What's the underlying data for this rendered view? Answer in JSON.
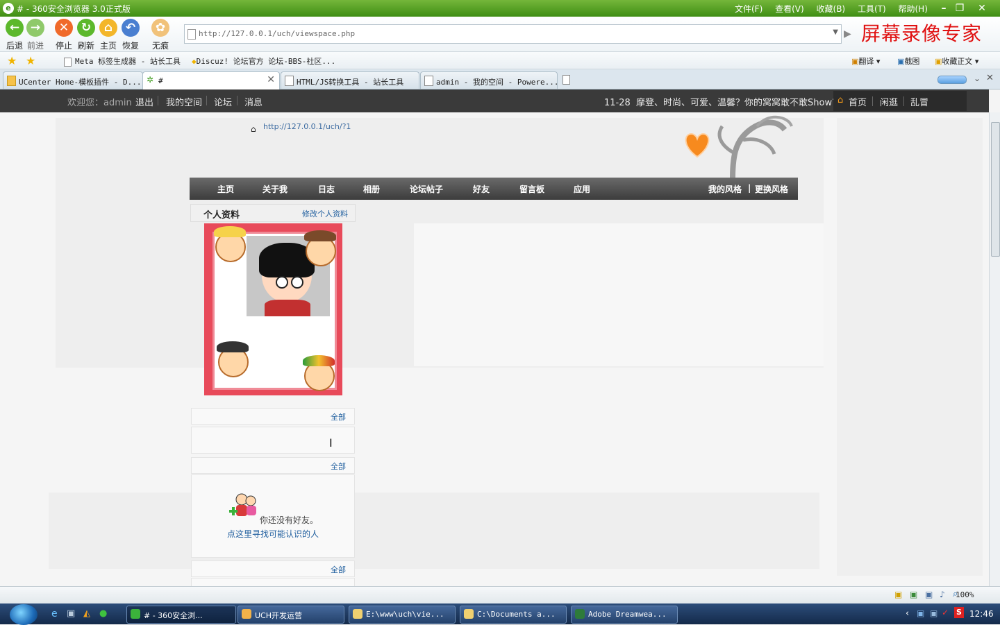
{
  "browser": {
    "title": "# - 360安全浏览器 3.0正式版",
    "menu": [
      "文件(F)",
      "查看(V)",
      "收藏(B)",
      "工具(T)",
      "帮助(H)"
    ],
    "toolbar": {
      "back": "后退",
      "forward": "前进",
      "stop": "停止",
      "refresh": "刷新",
      "home": "主页",
      "restore": "恢复",
      "incognito": "无痕"
    },
    "address": "http://127.0.0.1/uch/viewspace.php",
    "watermark": "屏幕录像专家",
    "favorites": [
      "Meta 标签生成器 - 站长工具",
      "Discuz! 论坛官方 论坛-BBS-社区..."
    ],
    "fav_right": [
      "翻译",
      "截图",
      "收藏正文"
    ],
    "tabs": [
      {
        "label": "UCenter Home-模板插件 - D..."
      },
      {
        "label": "#"
      },
      {
        "label": "HTML/JS转换工具 - 站长工具"
      },
      {
        "label": "admin - 我的空间 - Powere..."
      }
    ],
    "zoom": "100%"
  },
  "site": {
    "topbar": {
      "welcome": "欢迎您：admin",
      "logout": "退出",
      "myspace": "我的空间",
      "forum": "论坛",
      "messages": "消息",
      "news": "11-28  摩登、时尚、可爱、温馨？你的窝窝敢不敢Show?",
      "right_links": [
        "首页",
        "闲逛",
        "乱冒"
      ]
    },
    "space_url": "http://127.0.0.1/uch/?1",
    "nav": [
      "主页",
      "关于我",
      "日志",
      "相册",
      "论坛帖子",
      "好友",
      "留言板",
      "应用"
    ],
    "nav_right": [
      "我的风格",
      "更换风格"
    ],
    "profile": {
      "title": "个人资料",
      "edit": "修改个人资料"
    },
    "more_label": "全部",
    "no_friends": "你还没有好友。",
    "find_people": "点这里寻找可能认识的人"
  },
  "taskbar": {
    "tasks": [
      "# - 360安全浏...",
      "UCH开发运营",
      "E:\\www\\uch\\vie...",
      "C:\\Documents a...",
      "Adobe Dreamwea..."
    ],
    "clock": "12:46"
  },
  "colors": {
    "browser_green": "#4b9a1f",
    "site_dark": "#3a3a3a",
    "link_blue": "#1f5e9e",
    "frame_red": "#e84a5a"
  }
}
